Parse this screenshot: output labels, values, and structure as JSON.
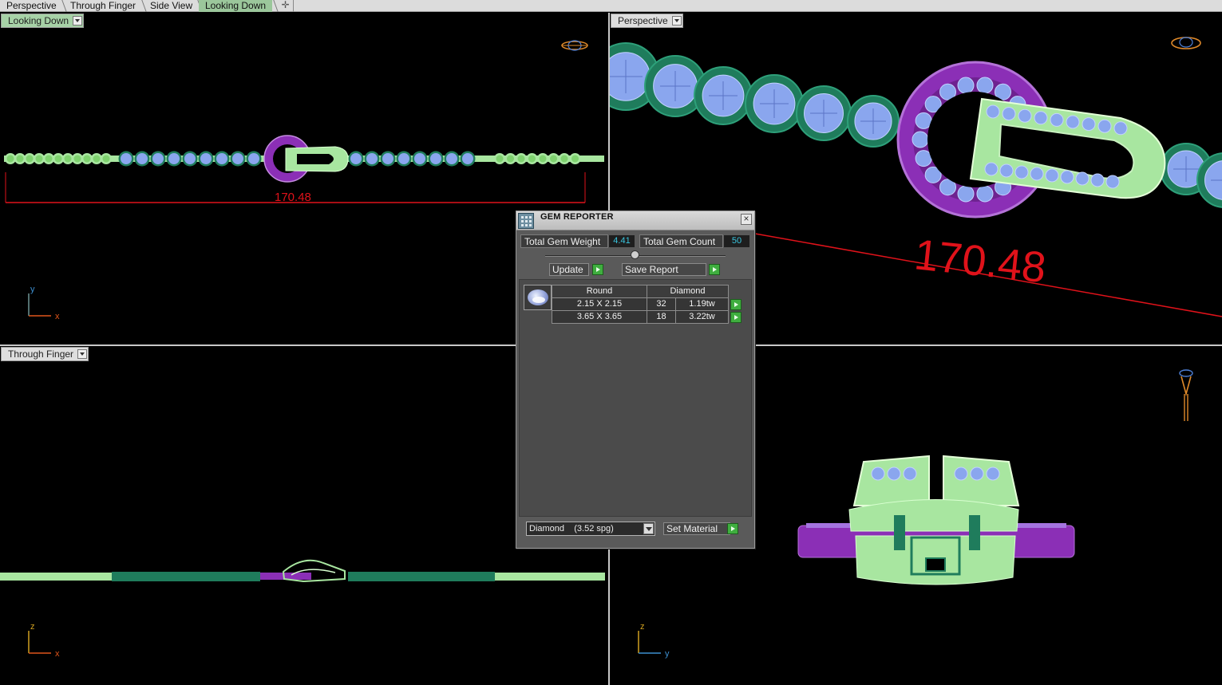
{
  "tabs": [
    {
      "label": "Perspective",
      "active": false
    },
    {
      "label": "Through Finger",
      "active": false
    },
    {
      "label": "Side View",
      "active": false
    },
    {
      "label": "Looking Down",
      "active": true
    }
  ],
  "tab_add_icon": "plus-icon",
  "viewports": {
    "top_left": {
      "label": "Looking Down",
      "dimension": "170.48",
      "axis_v": "y",
      "axis_h": "x"
    },
    "top_right": {
      "label": "Perspective",
      "dimension": "170.48"
    },
    "bottom_left": {
      "label": "Through Finger",
      "axis_v": "z",
      "axis_h": "x"
    },
    "bottom_right": {
      "label": "",
      "axis_v": "z",
      "axis_h": "y"
    }
  },
  "gem_reporter": {
    "title": "GEM REPORTER",
    "total_weight_label": "Total Gem Weight",
    "total_weight_value": "4.41",
    "total_count_label": "Total Gem Count",
    "total_count_value": "50",
    "update_label": "Update",
    "save_report_label": "Save Report",
    "table": {
      "shape": "Round",
      "material": "Diamond",
      "rows": [
        {
          "size": "2.15 X 2.15",
          "count": "32",
          "weight": "1.19tw"
        },
        {
          "size": "3.65 X 3.65",
          "count": "18",
          "weight": "3.22tw"
        }
      ]
    },
    "material_select": "Diamond    (3.52 spg)",
    "set_material_label": "Set Material"
  },
  "colors": {
    "tab_active": "#9bc79b",
    "gem_blue": "#8aa6ee",
    "setting_green": "#1f7c5c",
    "band_light_green": "#a8e6a0",
    "buckle_purple": "#8b2fb6",
    "dimension_red": "#e0121a",
    "value_cyan": "#39c6e0"
  }
}
